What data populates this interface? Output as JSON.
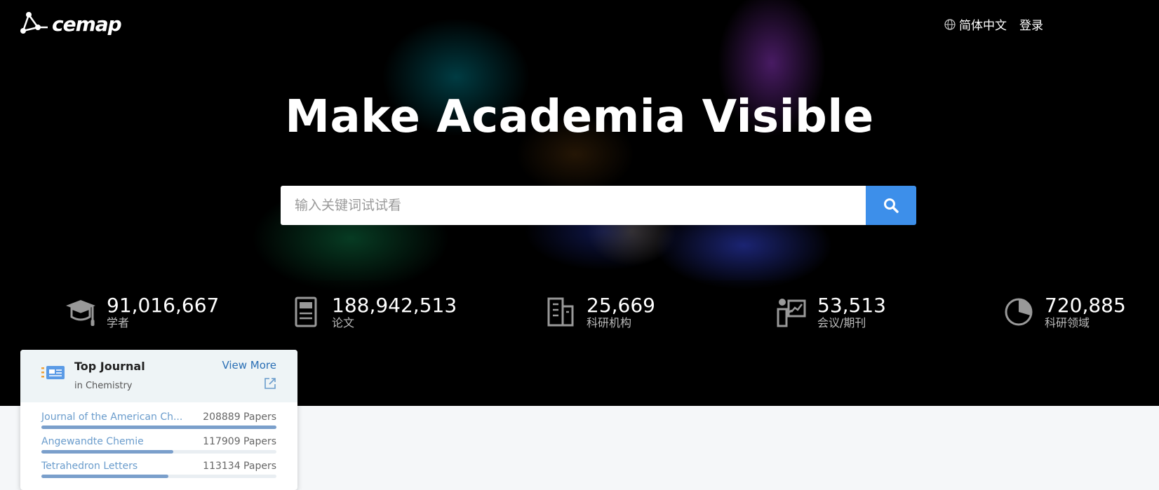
{
  "header": {
    "logo_text": "cemap",
    "lang_label": "简体中文",
    "login_label": "登录"
  },
  "hero": {
    "headline": "Make Academia Visible"
  },
  "search": {
    "placeholder": "输入关键词试试看"
  },
  "stats": [
    {
      "icon": "graduation-cap-icon",
      "value": "91,016,667",
      "label": "学者"
    },
    {
      "icon": "document-icon",
      "value": "188,942,513",
      "label": "论文"
    },
    {
      "icon": "building-icon",
      "value": "25,669",
      "label": "科研机构"
    },
    {
      "icon": "presentation-icon",
      "value": "53,513",
      "label": "会议/期刊"
    },
    {
      "icon": "pie-chart-icon",
      "value": "720,885",
      "label": "科研领域"
    }
  ],
  "top_journal": {
    "title": "Top Journal",
    "subtitle": "in Chemistry",
    "view_more": "View More",
    "items": [
      {
        "name": "Journal of the American Ch...",
        "count": "208889 Papers",
        "fill": 1.0
      },
      {
        "name": "Angewandte Chemie",
        "count": "117909 Papers",
        "fill": 0.56
      },
      {
        "name": "Tetrahedron Letters",
        "count": "113134 Papers",
        "fill": 0.54
      }
    ]
  },
  "colors": {
    "accent": "#3d8fea",
    "link": "#2a6fb5",
    "bar": "#7a9fcb"
  }
}
